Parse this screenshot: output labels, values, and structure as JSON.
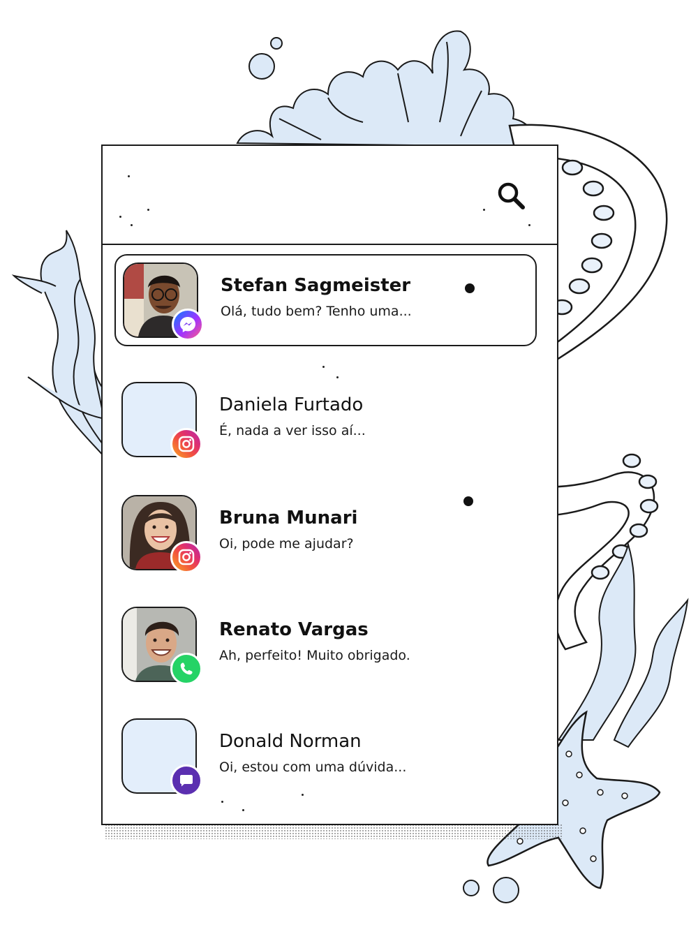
{
  "search": {
    "icon": "search-icon"
  },
  "conversations": [
    {
      "name": "Stefan Sagmeister",
      "preview": "Olá, tudo bem? Tenho uma...",
      "channel": "messenger",
      "channel_icon": "messenger-icon",
      "unread": true,
      "selected": true,
      "has_photo": true
    },
    {
      "name": "Daniela Furtado",
      "preview": "É, nada a ver isso aí...",
      "channel": "instagram",
      "channel_icon": "instagram-icon",
      "unread": false,
      "selected": false,
      "has_photo": false
    },
    {
      "name": "Bruna Munari",
      "preview": "Oi, pode me ajudar?",
      "channel": "instagram",
      "channel_icon": "instagram-icon",
      "unread": true,
      "selected": false,
      "has_photo": true
    },
    {
      "name": "Renato Vargas",
      "preview": "Ah, perfeito! Muito obrigado.",
      "channel": "whatsapp",
      "channel_icon": "whatsapp-icon",
      "unread": false,
      "selected": false,
      "has_photo": true
    },
    {
      "name": "Donald Norman",
      "preview": "Oi, estou com uma dúvida...",
      "channel": "chat",
      "channel_icon": "chat-bubble-icon",
      "unread": false,
      "selected": false,
      "has_photo": false
    }
  ],
  "colors": {
    "outline": "#1a1a1a",
    "avatar_placeholder": "#e3eefb",
    "illustration_tint": "#dce9f7",
    "whatsapp": "#25d366",
    "chat": "#5b2fb0",
    "messenger_start": "#0a7cff",
    "instagram_start": "#f9a825"
  }
}
